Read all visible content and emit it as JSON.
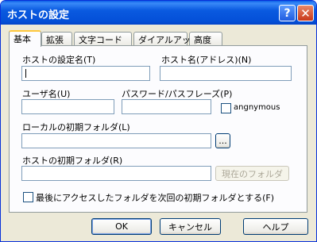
{
  "window": {
    "title": "ホストの設定"
  },
  "titlebar": {
    "help_label": "?",
    "close_label": "✕"
  },
  "tabs": [
    {
      "label": "基本",
      "active": true
    },
    {
      "label": "拡張",
      "active": false
    },
    {
      "label": "文字コード",
      "active": false
    },
    {
      "label": "ダイアルアップ",
      "active": false
    },
    {
      "label": "高度",
      "active": false
    }
  ],
  "form": {
    "host_setting_name": {
      "label": "ホストの設定名(T)",
      "value": ""
    },
    "host_name": {
      "label": "ホスト名(アドレス)(N)",
      "value": ""
    },
    "username": {
      "label": "ユーザ名(U)",
      "value": ""
    },
    "password": {
      "label": "パスワード/パスフレーズ(P)",
      "value": ""
    },
    "anonymous": {
      "label": "angnymous",
      "checked": false
    },
    "local_folder": {
      "label": "ローカルの初期フォルダ(L)",
      "value": "",
      "browse_label": "..."
    },
    "host_folder": {
      "label": "ホストの初期フォルダ(R)",
      "value": "",
      "current_folder_label": "現在のフォルダ"
    },
    "last_folder": {
      "label": "最後にアクセスしたフォルダを次回の初期フォルダとする(F)",
      "checked": false
    }
  },
  "buttons": {
    "ok": "OK",
    "cancel": "キャンセル",
    "help": "ヘルプ"
  }
}
